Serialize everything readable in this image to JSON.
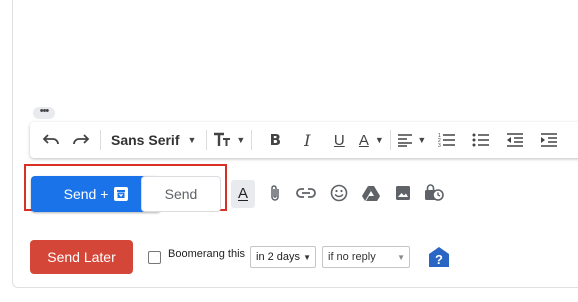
{
  "toolbar": {
    "undo_icon": "undo-icon",
    "redo_icon": "redo-icon",
    "font_name": "Sans Serif",
    "size_icon": "text-size-icon",
    "bold": "B",
    "italic": "I",
    "underline": "U",
    "text_color": "A"
  },
  "actions": {
    "send_plus_label": "Send +",
    "send_label": "Send",
    "format_label": "A"
  },
  "boomerang": {
    "send_later_label": "Send Later",
    "checkbox_label": "Boomerang this",
    "delay_value": "in 2 days",
    "condition_value": "if no reply"
  },
  "colors": {
    "primary_blue": "#1a73e8",
    "send_later_red": "#d44638",
    "highlight_red": "#d93025"
  }
}
